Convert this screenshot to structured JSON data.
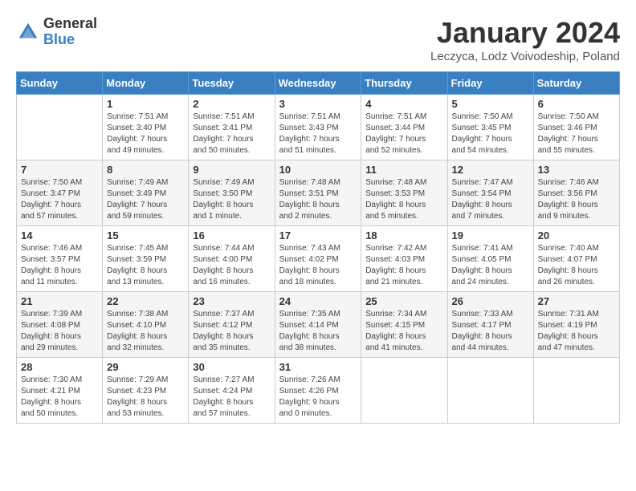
{
  "header": {
    "logo_general": "General",
    "logo_blue": "Blue",
    "month_title": "January 2024",
    "location": "Leczyca, Lodz Voivodeship, Poland"
  },
  "weekdays": [
    "Sunday",
    "Monday",
    "Tuesday",
    "Wednesday",
    "Thursday",
    "Friday",
    "Saturday"
  ],
  "weeks": [
    [
      {
        "day": "",
        "info": ""
      },
      {
        "day": "1",
        "info": "Sunrise: 7:51 AM\nSunset: 3:40 PM\nDaylight: 7 hours\nand 49 minutes."
      },
      {
        "day": "2",
        "info": "Sunrise: 7:51 AM\nSunset: 3:41 PM\nDaylight: 7 hours\nand 50 minutes."
      },
      {
        "day": "3",
        "info": "Sunrise: 7:51 AM\nSunset: 3:43 PM\nDaylight: 7 hours\nand 51 minutes."
      },
      {
        "day": "4",
        "info": "Sunrise: 7:51 AM\nSunset: 3:44 PM\nDaylight: 7 hours\nand 52 minutes."
      },
      {
        "day": "5",
        "info": "Sunrise: 7:50 AM\nSunset: 3:45 PM\nDaylight: 7 hours\nand 54 minutes."
      },
      {
        "day": "6",
        "info": "Sunrise: 7:50 AM\nSunset: 3:46 PM\nDaylight: 7 hours\nand 55 minutes."
      }
    ],
    [
      {
        "day": "7",
        "info": "Sunrise: 7:50 AM\nSunset: 3:47 PM\nDaylight: 7 hours\nand 57 minutes."
      },
      {
        "day": "8",
        "info": "Sunrise: 7:49 AM\nSunset: 3:49 PM\nDaylight: 7 hours\nand 59 minutes."
      },
      {
        "day": "9",
        "info": "Sunrise: 7:49 AM\nSunset: 3:50 PM\nDaylight: 8 hours\nand 1 minute."
      },
      {
        "day": "10",
        "info": "Sunrise: 7:48 AM\nSunset: 3:51 PM\nDaylight: 8 hours\nand 2 minutes."
      },
      {
        "day": "11",
        "info": "Sunrise: 7:48 AM\nSunset: 3:53 PM\nDaylight: 8 hours\nand 5 minutes."
      },
      {
        "day": "12",
        "info": "Sunrise: 7:47 AM\nSunset: 3:54 PM\nDaylight: 8 hours\nand 7 minutes."
      },
      {
        "day": "13",
        "info": "Sunrise: 7:46 AM\nSunset: 3:56 PM\nDaylight: 8 hours\nand 9 minutes."
      }
    ],
    [
      {
        "day": "14",
        "info": "Sunrise: 7:46 AM\nSunset: 3:57 PM\nDaylight: 8 hours\nand 11 minutes."
      },
      {
        "day": "15",
        "info": "Sunrise: 7:45 AM\nSunset: 3:59 PM\nDaylight: 8 hours\nand 13 minutes."
      },
      {
        "day": "16",
        "info": "Sunrise: 7:44 AM\nSunset: 4:00 PM\nDaylight: 8 hours\nand 16 minutes."
      },
      {
        "day": "17",
        "info": "Sunrise: 7:43 AM\nSunset: 4:02 PM\nDaylight: 8 hours\nand 18 minutes."
      },
      {
        "day": "18",
        "info": "Sunrise: 7:42 AM\nSunset: 4:03 PM\nDaylight: 8 hours\nand 21 minutes."
      },
      {
        "day": "19",
        "info": "Sunrise: 7:41 AM\nSunset: 4:05 PM\nDaylight: 8 hours\nand 24 minutes."
      },
      {
        "day": "20",
        "info": "Sunrise: 7:40 AM\nSunset: 4:07 PM\nDaylight: 8 hours\nand 26 minutes."
      }
    ],
    [
      {
        "day": "21",
        "info": "Sunrise: 7:39 AM\nSunset: 4:08 PM\nDaylight: 8 hours\nand 29 minutes."
      },
      {
        "day": "22",
        "info": "Sunrise: 7:38 AM\nSunset: 4:10 PM\nDaylight: 8 hours\nand 32 minutes."
      },
      {
        "day": "23",
        "info": "Sunrise: 7:37 AM\nSunset: 4:12 PM\nDaylight: 8 hours\nand 35 minutes."
      },
      {
        "day": "24",
        "info": "Sunrise: 7:35 AM\nSunset: 4:14 PM\nDaylight: 8 hours\nand 38 minutes."
      },
      {
        "day": "25",
        "info": "Sunrise: 7:34 AM\nSunset: 4:15 PM\nDaylight: 8 hours\nand 41 minutes."
      },
      {
        "day": "26",
        "info": "Sunrise: 7:33 AM\nSunset: 4:17 PM\nDaylight: 8 hours\nand 44 minutes."
      },
      {
        "day": "27",
        "info": "Sunrise: 7:31 AM\nSunset: 4:19 PM\nDaylight: 8 hours\nand 47 minutes."
      }
    ],
    [
      {
        "day": "28",
        "info": "Sunrise: 7:30 AM\nSunset: 4:21 PM\nDaylight: 8 hours\nand 50 minutes."
      },
      {
        "day": "29",
        "info": "Sunrise: 7:29 AM\nSunset: 4:23 PM\nDaylight: 8 hours\nand 53 minutes."
      },
      {
        "day": "30",
        "info": "Sunrise: 7:27 AM\nSunset: 4:24 PM\nDaylight: 8 hours\nand 57 minutes."
      },
      {
        "day": "31",
        "info": "Sunrise: 7:26 AM\nSunset: 4:26 PM\nDaylight: 9 hours\nand 0 minutes."
      },
      {
        "day": "",
        "info": ""
      },
      {
        "day": "",
        "info": ""
      },
      {
        "day": "",
        "info": ""
      }
    ]
  ]
}
